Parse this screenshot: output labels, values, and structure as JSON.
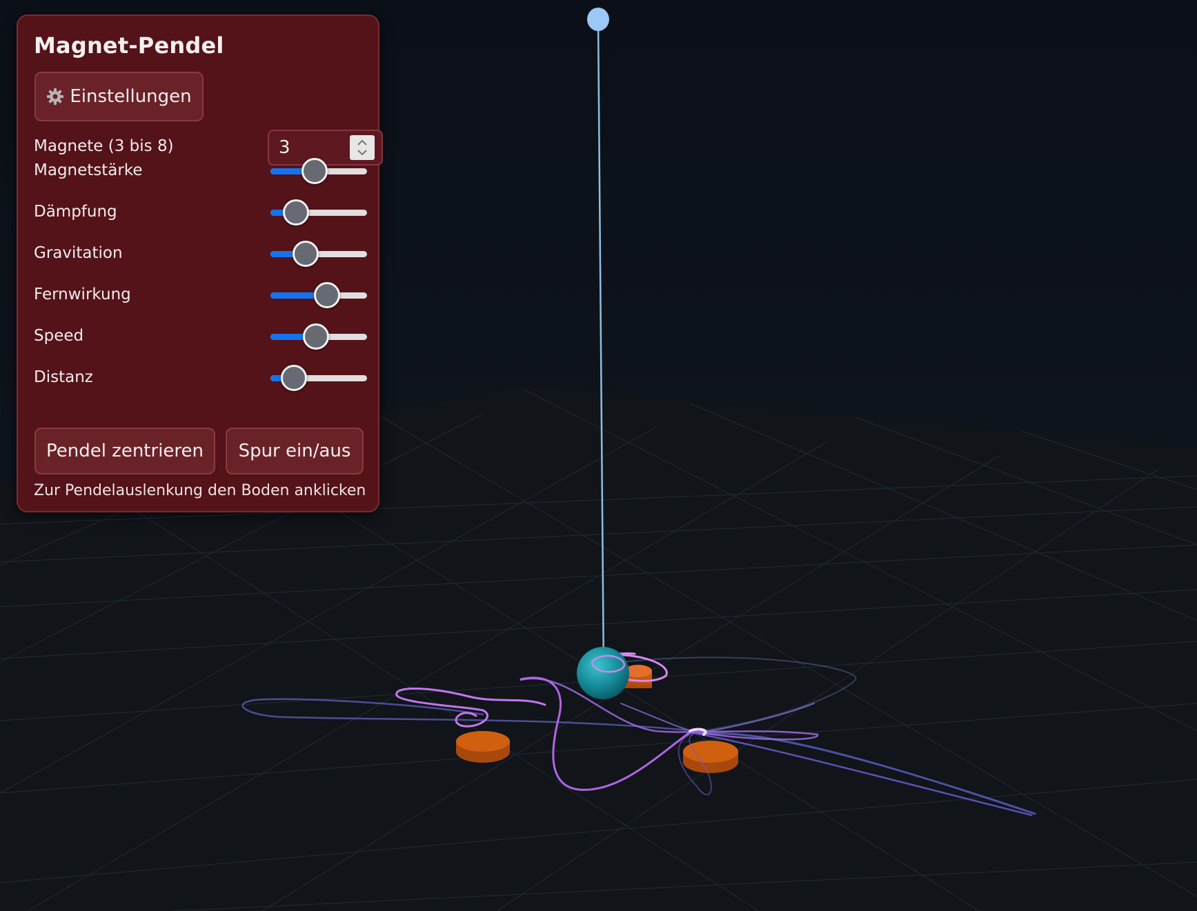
{
  "panel": {
    "title": "Magnet-Pendel",
    "settings_button": {
      "icon": "gear-icon",
      "label": "Einstellungen"
    },
    "magnets": {
      "label": "Magnete (3 bis 8)",
      "value": "3"
    },
    "sliders": [
      {
        "id": "magnetstaerke",
        "label": "Magnetstärke",
        "value": 0.44
      },
      {
        "id": "daempfung",
        "label": "Dämpfung",
        "value": 0.18
      },
      {
        "id": "gravitation",
        "label": "Gravitation",
        "value": 0.31
      },
      {
        "id": "fernwirkung",
        "label": "Fernwirkung",
        "value": 0.62
      },
      {
        "id": "speed",
        "label": "Speed",
        "value": 0.46
      },
      {
        "id": "distanz",
        "label": "Distanz",
        "value": 0.15
      }
    ],
    "center_button_label": "Pendel zentrieren",
    "trace_button_label": "Spur ein/aus",
    "hint": "Zur Pendelauslenkung den Boden anklicken"
  },
  "colors": {
    "panel_bg": "#541219",
    "slider_fill": "#1473f0",
    "pendulum_string": "#8fbde8",
    "pendulum_bob": "#1a8fa3",
    "magnet": "#c9590f",
    "trace": "#c875ff",
    "background": "#0c1016"
  },
  "scene": {
    "magnet_count": 3,
    "trace_visible": true
  }
}
